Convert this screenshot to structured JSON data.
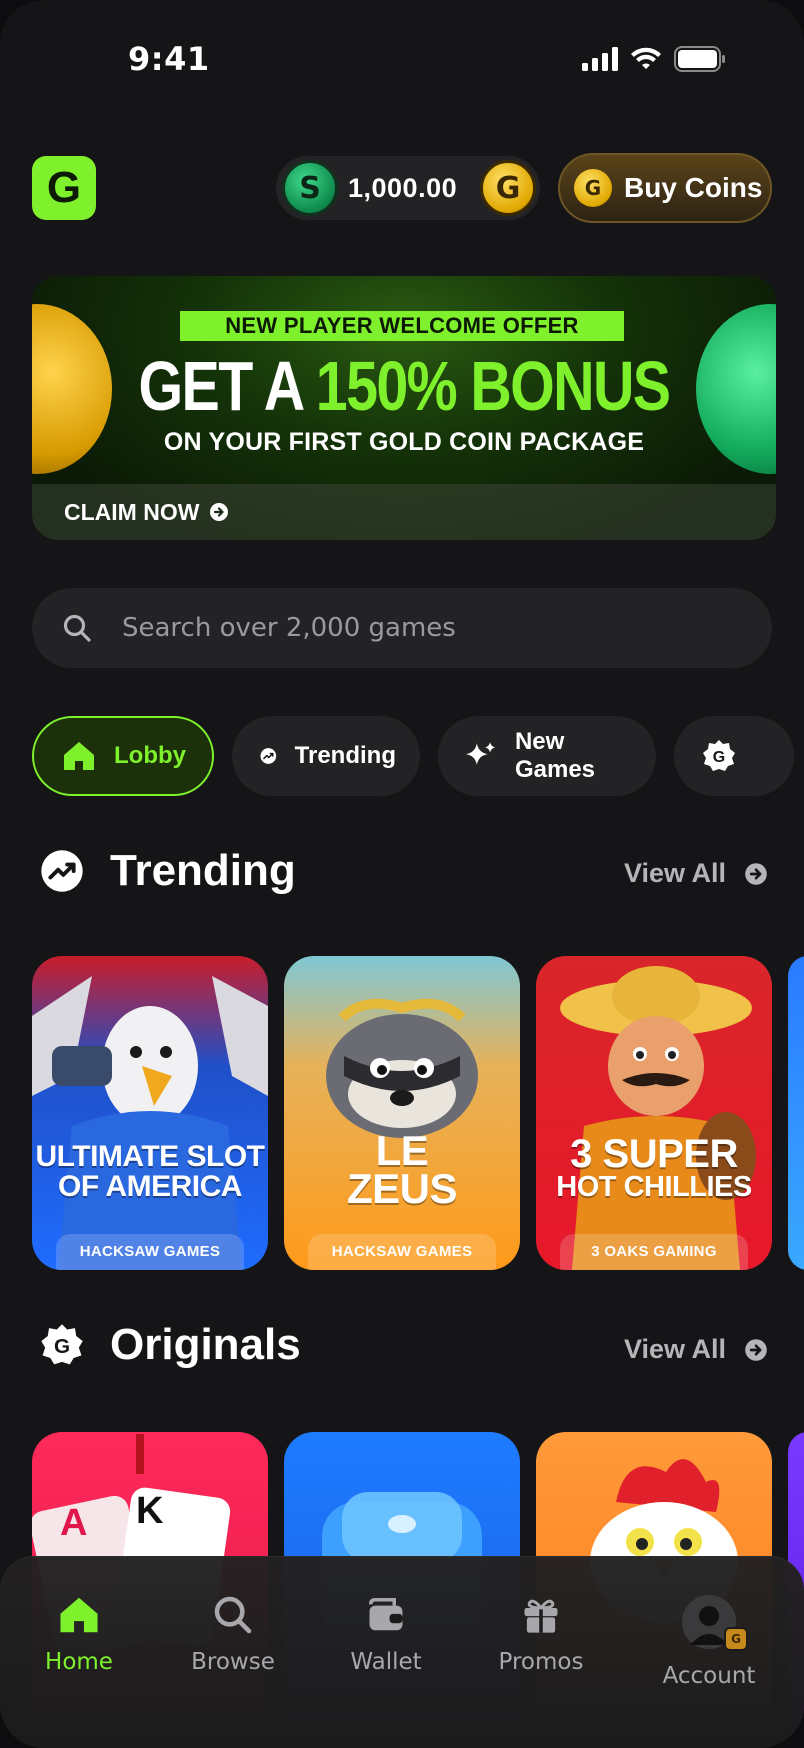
{
  "status_bar": {
    "time": "9:41"
  },
  "header": {
    "logo_letter": "G",
    "balance": {
      "currency_letter": "S",
      "amount": "1,000.00",
      "coin_letter": "G"
    },
    "buy_button": {
      "label": "Buy Coins",
      "coin_letter": "G"
    }
  },
  "banner": {
    "tag": "NEW PLAYER WELCOME OFFER",
    "headline_prefix": "GET A ",
    "headline_highlight": "150% BONUS",
    "subline": "ON YOUR FIRST GOLD COIN PACKAGE",
    "cta": "CLAIM NOW"
  },
  "search": {
    "placeholder": "Search over 2,000 games"
  },
  "chips": [
    {
      "label": "Lobby",
      "icon": "home-icon",
      "active": true
    },
    {
      "label": "Trending",
      "icon": "trending-icon"
    },
    {
      "label": "New Games",
      "icon": "sparkles-icon"
    },
    {
      "label": "",
      "icon": "originals-icon"
    }
  ],
  "trending": {
    "title": "Trending",
    "view_all": "View All",
    "games": [
      {
        "title_line1": "ULTIMATE SLOT",
        "title_line2": "OF AMERICA",
        "provider": "HACKSAW GAMES"
      },
      {
        "title_line1": "LE",
        "title_line2": "ZEUS",
        "provider": "HACKSAW GAMES"
      },
      {
        "title_line1": "3 SUPER",
        "title_line2": "HOT CHILLIES",
        "provider": "3 OAKS GAMING"
      }
    ]
  },
  "originals": {
    "title": "Originals",
    "view_all": "View All",
    "cards": [
      {
        "card1": "A",
        "card2": "K"
      },
      {
        "icon": "dice-icon"
      },
      {
        "icon": "chicken-icon"
      }
    ]
  },
  "nav": {
    "items": [
      {
        "label": "Home",
        "icon": "home-icon",
        "active": true
      },
      {
        "label": "Browse",
        "icon": "search-icon"
      },
      {
        "label": "Wallet",
        "icon": "wallet-icon"
      },
      {
        "label": "Promos",
        "icon": "gift-icon"
      },
      {
        "label": "Account",
        "icon": "avatar-icon",
        "badge": "G"
      }
    ]
  },
  "colors": {
    "accent": "#7ef02c",
    "background": "#151517",
    "surface": "#232325"
  }
}
